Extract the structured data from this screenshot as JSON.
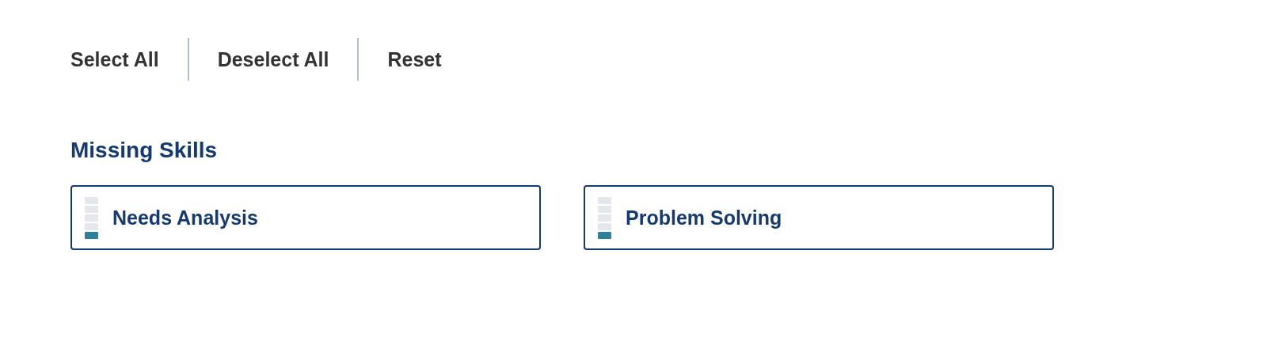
{
  "actions": [
    "Select All",
    "Deselect All",
    "Reset"
  ],
  "section": {
    "title": "Missing Skills",
    "skills": [
      {
        "name": "Needs Analysis",
        "level": 0.2
      },
      {
        "name": "Problem Solving",
        "level": 0.2
      }
    ]
  }
}
